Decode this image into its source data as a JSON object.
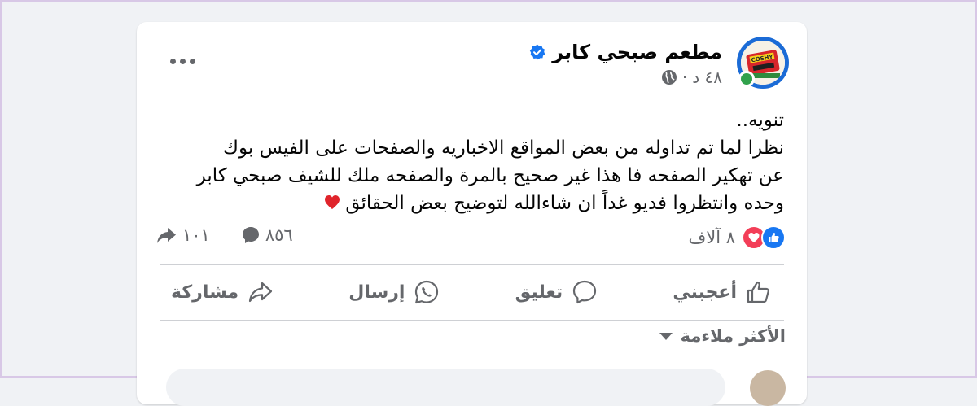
{
  "post": {
    "page_name": "مطعم صبحي كابر",
    "time": "٤٨ د",
    "separator": "·",
    "text_lines": [
      "تنويه..",
      "نظرا لما تم تداوله من بعض المواقع الاخباريه والصفحات على الفيس بوك",
      "عن تهكير الصفحه فا هذا غير صحيح بالمرة والصفحه ملك للشيف صبحي كابر",
      "وحده وانتظروا فديو غداً ان شاءالله لتوضيح بعض الحقائق"
    ],
    "avatar_text": "COSHY"
  },
  "stats": {
    "reactions_count": "٨ آلاف",
    "comments_count": "٨٥٦",
    "shares_count": "١٠١"
  },
  "actions": {
    "like_label": "أعجبني",
    "comment_label": "تعليق",
    "send_label": "إرسال",
    "share_label": "مشاركة"
  },
  "comments": {
    "sort_label": "الأكثر ملاءمة"
  },
  "icons": {
    "verified": "verified-badge-icon",
    "globe": "globe-icon",
    "more": "more-options-icon",
    "like": "thumbs-up-icon",
    "love": "heart-icon",
    "comment": "speech-bubble-icon",
    "send": "whatsapp-icon",
    "share": "share-arrow-icon",
    "emoji": "red-heart-emoji"
  },
  "colors": {
    "accent": "#1877f2",
    "love": "#f33e58",
    "online": "#31a24c",
    "secondary_text": "#65676b",
    "background": "#f0f2f5"
  }
}
